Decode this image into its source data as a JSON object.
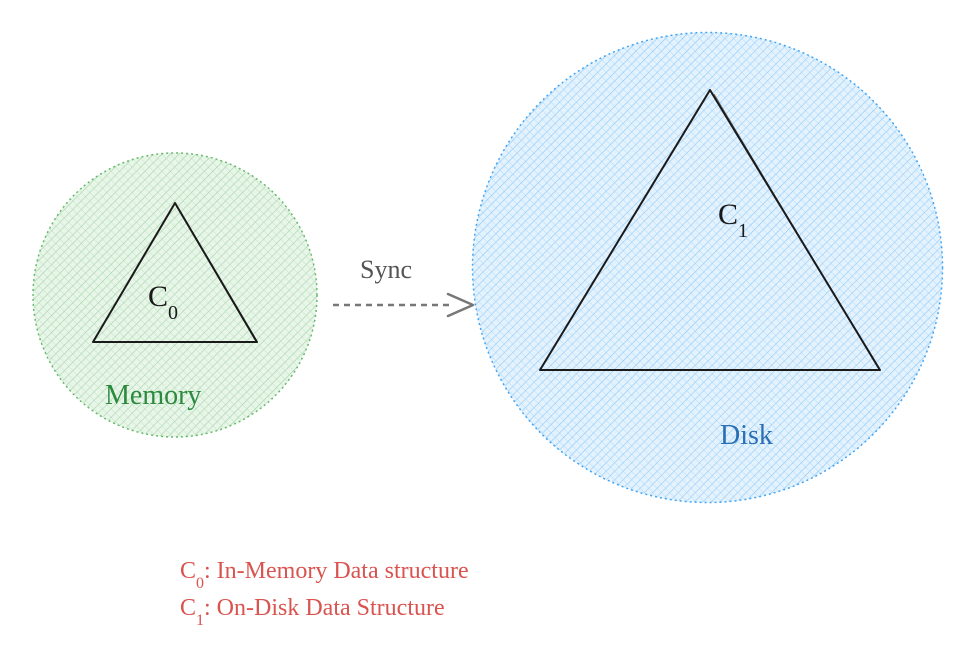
{
  "diagram": {
    "memory": {
      "label": "Memory",
      "circle_color": "#c8e6c9",
      "border_color": "#81c784",
      "triangle_label_prefix": "C",
      "triangle_label_sub": "0"
    },
    "disk": {
      "label": "Disk",
      "circle_color": "#bbdefb",
      "border_color": "#64b5f6",
      "triangle_label_prefix": "C",
      "triangle_label_sub": "1"
    },
    "arrow": {
      "label": "Sync"
    },
    "legend": {
      "c0_prefix": "C",
      "c0_sub": "0",
      "c0_desc": ": In-Memory Data structure",
      "c1_prefix": "C",
      "c1_sub": "1",
      "c1_desc": ": On-Disk Data Structure"
    }
  }
}
